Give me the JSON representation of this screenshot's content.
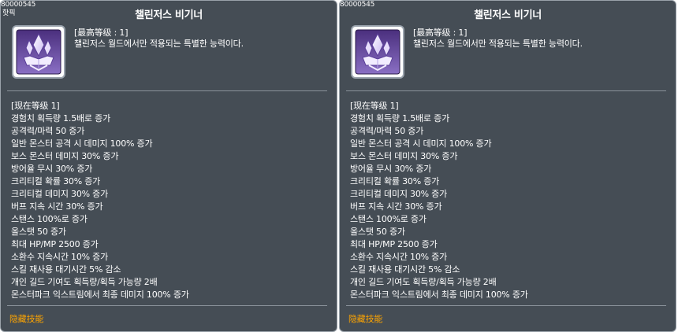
{
  "tooltips": [
    {
      "skill_id": "80000545",
      "skill_id_sub": "핫픽",
      "title": "챌린저스 비기너",
      "max_level_label": "[最高等级 : 1]",
      "description": "챌린저스 월드에서만 적용되는 특별한 능력이다.",
      "current_level_label": "[现在等级 1]",
      "effects": [
        "경험치 획득량 1.5배로 증가",
        "공격력/마력 50 증가",
        "일반 몬스터 공격 시 데미지 100% 증가",
        "보스 몬스터  데미지 30% 증가",
        "방어율 무시 30% 증가",
        "크리티컬 확률 30% 증가",
        "크리티컬 데미지 30% 증가",
        "버프 지속 시간 30% 증가",
        "스탠스 100%로 증가",
        "올스탯 50 증가",
        "최대 HP/MP 2500 증가",
        "소환수 지속시간 10% 증가",
        "스킬 재사용 대기시간 5% 감소",
        "개인 길드 기여도 획득량/획득 가능량 2배",
        "몬스터파크 익스트림에서 최종 데미지 100% 증가"
      ],
      "footer_link": "隐藏技能",
      "icon": "crystal-crown-icon"
    },
    {
      "skill_id": "80000545",
      "skill_id_sub": "",
      "title": "챌린저스 비기너",
      "max_level_label": "[最高等级 : 1]",
      "description": "챌린저스 월드에서만 적용되는 특별한 능력이다.",
      "current_level_label": "[现在等级 1]",
      "effects": [
        "경험치 획득량 1.5배로 증가",
        "공격력/마력 50 증가",
        "일반 몬스터 공격 시 데미지 100% 증가",
        "보스 몬스터  데미지 30% 증가",
        "방어율 무시 30% 증가",
        "크리티컬 확률 30% 증가",
        "크리티컬 데미지 30% 증가",
        "버프 지속 시간 30% 증가",
        "스탠스 100%로 증가",
        "올스탯 50 증가",
        "최대 HP/MP 2500 증가",
        "소환수 지속시간 10% 증가",
        "스킬 재사용 대기시간 5% 감소",
        "개인 길드 기여도 획득량/획득 가능량 2배",
        "몬스터파크 익스트림에서 최종 데미지 100% 증가"
      ],
      "footer_link": "隐藏技能",
      "icon": "crystal-crown-icon"
    }
  ],
  "colors": {
    "panel_bg": "#454d55",
    "panel_border": "#9aa2aa",
    "link": "#ffa500",
    "icon_purple": "#7d5bb8"
  }
}
